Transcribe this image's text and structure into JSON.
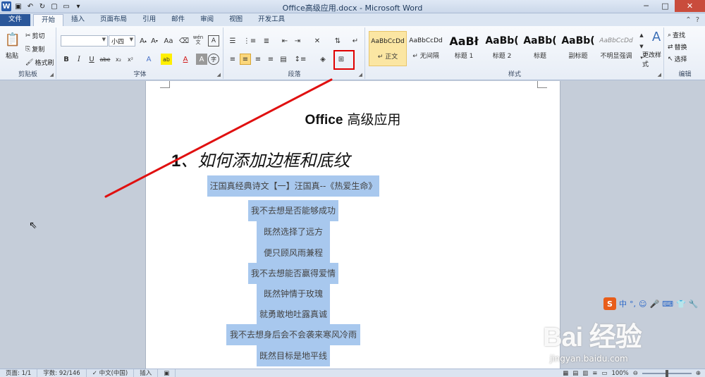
{
  "window": {
    "title": "Office高级应用.docx - Microsoft Word",
    "minimize": "─",
    "maximize": "□",
    "close": "✕"
  },
  "tabs": [
    "文件",
    "开始",
    "插入",
    "页面布局",
    "引用",
    "邮件",
    "审阅",
    "视图",
    "开发工具"
  ],
  "clipboard": {
    "paste": "粘贴",
    "cut": "剪切",
    "copy": "复制",
    "format_painter": "格式刷",
    "label": "剪贴板"
  },
  "font": {
    "font_name": "",
    "font_size": "小四",
    "wen": "wén",
    "label": "字体",
    "aa": "Aa"
  },
  "paragraph": {
    "label": "段落"
  },
  "styles": {
    "label": "样式",
    "items": [
      {
        "sample": "AaBbCcDd",
        "name": "↵ 正文"
      },
      {
        "sample": "AaBbCcDd",
        "name": "↵ 无间隔"
      },
      {
        "sample": "AaBł",
        "name": "标题 1"
      },
      {
        "sample": "AaBb(",
        "name": "标题 2"
      },
      {
        "sample": "AaBb(",
        "name": "标题"
      },
      {
        "sample": "AaBb(",
        "name": "副标题"
      },
      {
        "sample": "AaBbCcDd",
        "name": "不明显强调"
      }
    ],
    "change_styles": "更改样式"
  },
  "editing": {
    "find": "查找",
    "replace": "替换",
    "select": "选择",
    "label": "编辑"
  },
  "document": {
    "title_bold": "Office",
    "title_rest": " 高级应用",
    "heading_num": "1",
    "heading_text": "、如何添加边框和底纹",
    "poem": [
      "汪国真经典诗文【一】汪国真--《热爱生命》",
      "我不去想是否能够成功",
      "既然选择了远方",
      "便只顾风雨兼程",
      "我不去想能否赢得爱情",
      "既然钟情于玫瑰",
      "就勇敢地吐露真诚",
      "我不去想身后会不会袭来寒风冷雨",
      "既然目标是地平线"
    ]
  },
  "ime": {
    "logo": "S",
    "mode": "中"
  },
  "watermark": {
    "main": "Bai 经验",
    "url": "jingyan.baidu.com"
  },
  "status": {
    "page": "页面: 1/1",
    "words": "字数: 92/146",
    "lang": "中文(中国)",
    "insert": "插入",
    "zoom": "100%"
  }
}
